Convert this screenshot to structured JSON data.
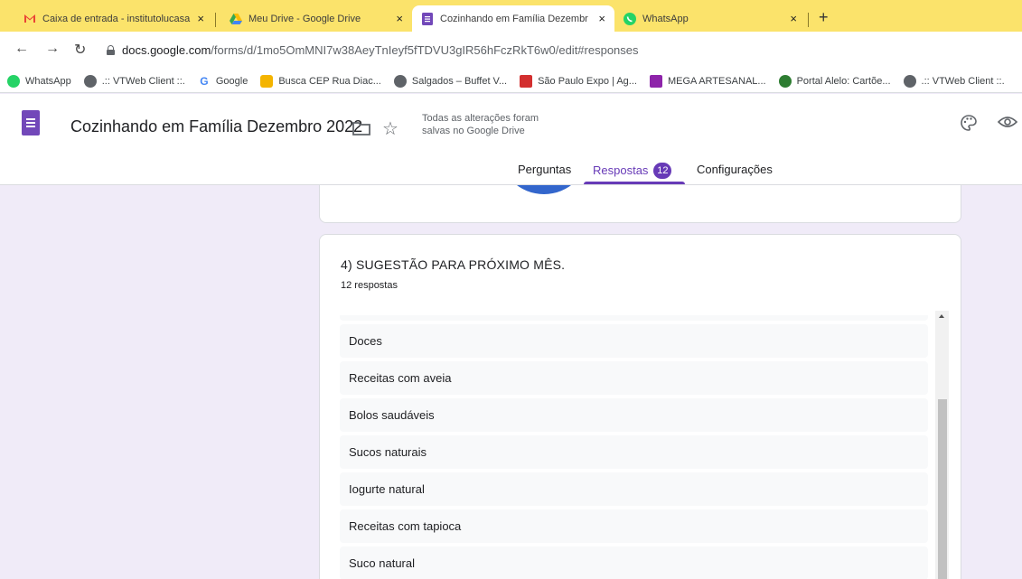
{
  "browser": {
    "tabs": [
      {
        "title": "Caixa de entrada - institutolucasa",
        "icon": "gmail-icon",
        "active": false
      },
      {
        "title": "Meu Drive - Google Drive",
        "icon": "google-drive-icon",
        "active": false
      },
      {
        "title": "Cozinhando em Família Dezembr",
        "icon": "google-forms-icon",
        "active": true
      },
      {
        "title": "WhatsApp",
        "icon": "whatsapp-icon",
        "active": false
      }
    ],
    "new_tab": "+",
    "close_glyph": "×",
    "url_host": "docs.google.com",
    "url_path": "/forms/d/1mo5OmMNI7w38AeyTnIeyf5fTDVU3gIR56hFczRkT6w0/edit#responses",
    "bookmarks": [
      {
        "label": "WhatsApp",
        "icon": "whatsapp-icon",
        "color": "#25d366"
      },
      {
        "label": ".:: VTWeb Client ::.",
        "icon": "globe-icon",
        "color": "#5f6368"
      },
      {
        "label": "Google",
        "icon": "google-icon",
        "color": "#4285f4"
      },
      {
        "label": "Busca CEP Rua Diac...",
        "icon": "cep-icon",
        "color": "#f4b400"
      },
      {
        "label": "Salgados – Buffet V...",
        "icon": "globe-icon",
        "color": "#5f6368"
      },
      {
        "label": "São Paulo Expo | Ag...",
        "icon": "expo-icon",
        "color": "#d32f2f"
      },
      {
        "label": "MEGA ARTESANAL...",
        "icon": "mega-artesanal-icon",
        "color": "#8e24aa"
      },
      {
        "label": "Portal Alelo: Cartõe...",
        "icon": "alelo-icon",
        "color": "#2e7d32"
      },
      {
        "label": ".:: VTWeb Client ::.",
        "icon": "globe-icon",
        "color": "#5f6368"
      }
    ]
  },
  "form": {
    "title": "Cozinhando em Família Dezembro 2022",
    "save_status": "Todas as alterações foram salvas no Google Drive",
    "tabs": {
      "questions": "Perguntas",
      "responses": "Respostas",
      "responses_count": "12",
      "settings": "Configurações"
    },
    "accent": "#673ab7",
    "background": "#f0ebf8"
  },
  "question": {
    "title": "4) SUGESTÃO PARA PRÓXIMO MÊS.",
    "count": "12 respostas",
    "answers": [
      "Doces",
      "Receitas com aveia",
      "Bolos saudáveis",
      "Sucos naturais",
      "Iogurte natural",
      "Receitas com tapioca",
      "Suco natural"
    ]
  }
}
